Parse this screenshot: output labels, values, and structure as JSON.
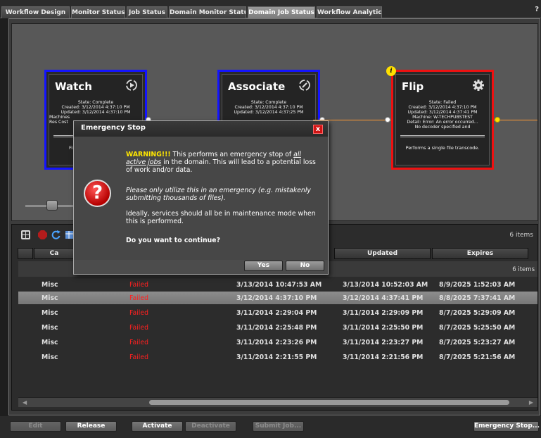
{
  "tabs": [
    "Workflow Design",
    "Monitor Status",
    "Job Status",
    "Domain Monitor Status",
    "Domain Job Status",
    "Workflow Analytics"
  ],
  "help": "?",
  "nodes": [
    {
      "title": "Watch",
      "icon": "play-cycle-icon",
      "details": [
        "State: Complete",
        "Created: 3/12/2014 4:37:10 PM",
        "Updated: 3/12/2014 4:37:10 PM",
        "Machines",
        "Res Cost"
      ],
      "desc": "Fi",
      "status": "complete"
    },
    {
      "title": "Associate",
      "icon": "attach-cycle-icon",
      "details": [
        "State: Complete",
        "Created: 3/12/2014 4:37:10 PM",
        "Updated: 3/12/2014 4:37:25 PM"
      ],
      "desc": "",
      "status": "complete"
    },
    {
      "title": "Flip",
      "icon": "gear-icon",
      "details": [
        "State: Failed",
        "Created: 3/12/2014 4:37:10 PM",
        "Updated: 3/12/2014 4:37:41 PM",
        "Machine: W-TECHPUBSTEST",
        "Detail: Error: An error occurred...",
        "No decoder specified and"
      ],
      "desc": "Performs a single file transcode.",
      "status": "failed",
      "badge": "i"
    }
  ],
  "grid": {
    "items_count": "6 items",
    "columns": [
      "Ca",
      "Updated",
      "Expires"
    ],
    "group_count": "6 items",
    "rows": [
      {
        "category": "Misc",
        "state": "Failed",
        "created": "3/13/2014 10:47:53 AM",
        "updated": "3/13/2014 10:52:03 AM",
        "expires": "8/9/2025 1:52:03 AM",
        "selected": false
      },
      {
        "category": "Misc",
        "state": "Failed",
        "created": "3/12/2014 4:37:10 PM",
        "updated": "3/12/2014 4:37:41 PM",
        "expires": "8/8/2025 7:37:41 AM",
        "selected": true
      },
      {
        "category": "Misc",
        "state": "Failed",
        "created": "3/11/2014 2:29:04 PM",
        "updated": "3/11/2014 2:29:09 PM",
        "expires": "8/7/2025 5:29:09 AM",
        "selected": false
      },
      {
        "category": "Misc",
        "state": "Failed",
        "created": "3/11/2014 2:25:48 PM",
        "updated": "3/11/2014 2:25:50 PM",
        "expires": "8/7/2025 5:25:50 AM",
        "selected": false
      },
      {
        "category": "Misc",
        "state": "Failed",
        "created": "3/11/2014 2:23:26 PM",
        "updated": "3/11/2014 2:23:27 PM",
        "expires": "8/7/2025 5:23:27 AM",
        "selected": false
      },
      {
        "category": "Misc",
        "state": "Failed",
        "created": "3/11/2014 2:21:55 PM",
        "updated": "3/11/2014 2:21:56 PM",
        "expires": "8/7/2025 5:21:56 AM",
        "selected": false
      }
    ]
  },
  "buttons": {
    "edit": "Edit",
    "release": "Release",
    "activate": "Activate",
    "deactivate": "Deactivate",
    "submit": "Submit Job...",
    "emergency": "Emergency Stop..."
  },
  "dialog": {
    "title": "Emergency Stop",
    "close": "x",
    "icon": "question-icon",
    "warning_label": "WARNING!!!",
    "warning_text1": " This performs an emergency stop of ",
    "warning_emph": "all active jobs",
    "warning_text2": " in the domain.  This will lead to a potential loss of work and/or data.",
    "note": "Please only utilize this in an emergency (e.g. mistakenly submitting thousands of files).",
    "ideal": "Ideally, services should all be in maintenance mode when this is performed.",
    "question": "Do you want to continue?",
    "yes": "Yes",
    "no": "No"
  },
  "colors": {
    "complete_border": "#1414ff",
    "failed_border": "#ee1111",
    "failed_text": "#ff2020",
    "warning": "#ffe600",
    "link": "#ff9933"
  }
}
